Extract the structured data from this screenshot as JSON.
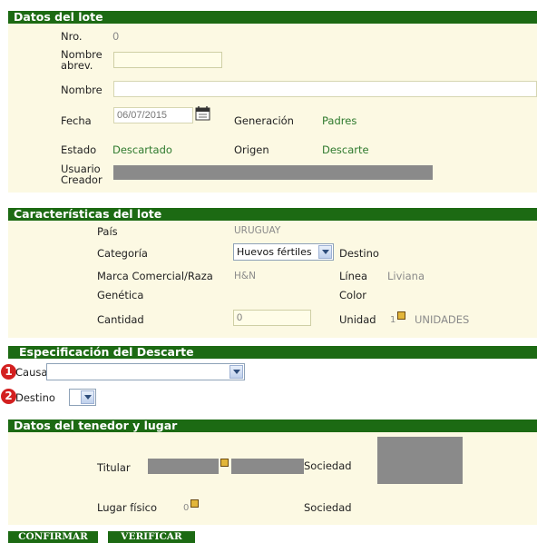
{
  "datos_lote": {
    "title": "Datos del lote",
    "nro_label": "Nro.",
    "nro_value": "0",
    "nombre_abrev_label": "Nombre\nabrev.",
    "nombre_label": "Nombre",
    "fecha_label": "Fecha",
    "fecha_value": "06/07/2015",
    "generacion_label": "Generación",
    "generacion_value": "Padres",
    "estado_label": "Estado",
    "estado_value": "Descartado",
    "origen_label": "Origen",
    "origen_value": "Descarte",
    "usuario_label": "Usuario\nCreador"
  },
  "caracteristicas": {
    "title": "Características del lote",
    "pais_label": "País",
    "pais_value": "URUGUAY",
    "categoria_label": "Categoría",
    "categoria_value": "Huevos fértiles",
    "destino_label": "Destino",
    "marca_label": "Marca Comercial/Raza",
    "marca_value": "H&N",
    "linea_label": "Línea",
    "linea_value": "Liviana",
    "genetica_label": "Genética",
    "color_label": "Color",
    "cantidad_label": "Cantidad",
    "cantidad_value": "0",
    "unidad_label": "Unidad",
    "unidad_code": "1",
    "unidad_value": "UNIDADES"
  },
  "descarte": {
    "title": "Especificación del Descarte",
    "badge1": "1",
    "causas_label": "Causas",
    "badge2": "2",
    "destino_label": "Destino"
  },
  "tenedor": {
    "title": "Datos del tenedor y lugar",
    "titular_label": "Titular",
    "sociedad_label": "Sociedad",
    "lugar_label": "Lugar físico",
    "lugar_code": "0",
    "sociedad2_label": "Sociedad"
  },
  "buttons": {
    "confirmar": "CONFIRMAR",
    "verificar": "VERIFICAR"
  },
  "icons": {
    "calendar": "calendar-icon",
    "lookup": "lookup-icon",
    "dropdown": "chevron-down-icon"
  }
}
